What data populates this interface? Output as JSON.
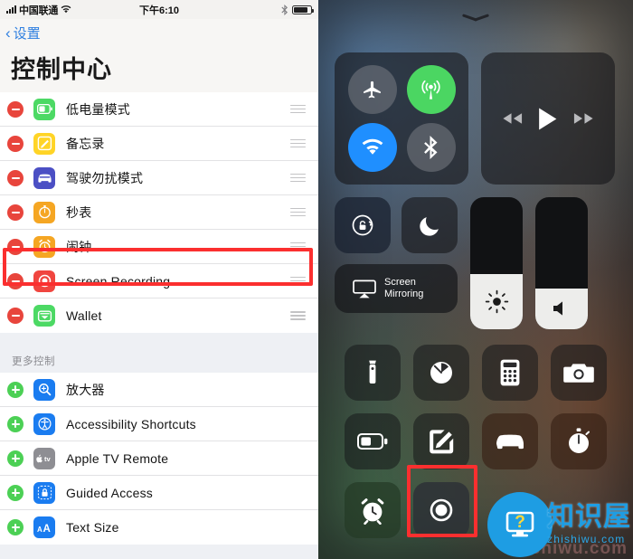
{
  "status_bar": {
    "carrier": "中国联通",
    "time": "下午6:10",
    "signal_icon": "signal-bars-icon",
    "wifi_icon": "wifi-icon",
    "bluetooth_icon": "bluetooth-icon",
    "battery_icon": "battery-icon"
  },
  "nav": {
    "back_label": "设置",
    "back_icon": "chevron-left-icon",
    "page_title": "控制中心"
  },
  "included_section": {
    "items": [
      {
        "label": "低电量模式",
        "icon": "battery-low-power-icon",
        "icon_color": "#4cd964",
        "action": "remove"
      },
      {
        "label": "备忘录",
        "icon": "notes-icon",
        "icon_color": "#ffd426",
        "action": "remove"
      },
      {
        "label": "驾驶勿扰模式",
        "icon": "car-do-not-disturb-icon",
        "icon_color": "#4b4fc4",
        "action": "remove"
      },
      {
        "label": "秒表",
        "icon": "stopwatch-icon",
        "icon_color": "#f5a623",
        "action": "remove"
      },
      {
        "label": "闹钟",
        "icon": "alarm-clock-icon",
        "icon_color": "#f5a623",
        "action": "remove"
      },
      {
        "label": "Screen Recording",
        "icon": "screen-recording-icon",
        "icon_color": "#f0453f",
        "action": "remove",
        "highlighted": true
      },
      {
        "label": "Wallet",
        "icon": "wallet-icon",
        "icon_color": "#4cd964",
        "action": "remove"
      }
    ]
  },
  "more_section": {
    "header": "更多控制",
    "items": [
      {
        "label": "放大器",
        "icon": "magnifier-icon",
        "icon_color": "#1a7cf0",
        "action": "add"
      },
      {
        "label": "Accessibility Shortcuts",
        "icon": "accessibility-icon",
        "icon_color": "#1a7cf0",
        "action": "add"
      },
      {
        "label": "Apple TV Remote",
        "icon": "apple-tv-remote-icon",
        "icon_color": "#8e8e93",
        "action": "add"
      },
      {
        "label": "Guided Access",
        "icon": "guided-access-lock-icon",
        "icon_color": "#1a7cf0",
        "action": "add"
      },
      {
        "label": "Text Size",
        "icon": "text-size-icon",
        "icon_color": "#1a7cf0",
        "action": "add"
      }
    ]
  },
  "control_center": {
    "grabber_icon": "chevron-down-grabber-icon",
    "connectivity": [
      {
        "name": "airplane-mode-toggle",
        "icon": "airplane-icon",
        "state": "off"
      },
      {
        "name": "cellular-data-toggle",
        "icon": "cellular-antenna-icon",
        "state": "on",
        "color": "#4bd662"
      },
      {
        "name": "wifi-toggle",
        "icon": "wifi-icon",
        "state": "on",
        "color": "#1f8fff"
      },
      {
        "name": "bluetooth-toggle",
        "icon": "bluetooth-icon",
        "state": "off"
      }
    ],
    "media": [
      {
        "name": "rewind-button",
        "icon": "rewind-icon"
      },
      {
        "name": "play-button",
        "icon": "play-icon"
      },
      {
        "name": "fast-forward-button",
        "icon": "fast-forward-icon"
      }
    ],
    "rotation_lock": {
      "icon": "rotation-lock-icon",
      "state": "on"
    },
    "do_not_disturb": {
      "icon": "moon-icon",
      "state": "off"
    },
    "screen_mirroring": {
      "label_line1": "Screen",
      "label_line2": "Mirroring",
      "icon": "airplay-icon"
    },
    "brightness_slider": {
      "icon": "brightness-sun-icon",
      "value_percent": 42
    },
    "volume_slider": {
      "icon": "speaker-icon",
      "value_percent": 31
    },
    "apps": [
      {
        "name": "flashlight-tile",
        "icon": "flashlight-icon",
        "tint": "dark"
      },
      {
        "name": "timer-tile",
        "icon": "timer-icon",
        "tint": "dark"
      },
      {
        "name": "calculator-tile",
        "icon": "calculator-icon",
        "tint": "dark"
      },
      {
        "name": "camera-tile",
        "icon": "camera-icon",
        "tint": "dark"
      },
      {
        "name": "low-power-tile",
        "icon": "battery-low-power-icon",
        "tint": "dark"
      },
      {
        "name": "notes-tile",
        "icon": "notes-pencil-icon",
        "tint": "dark"
      },
      {
        "name": "driving-dnd-tile",
        "icon": "car-icon",
        "tint": "warm"
      },
      {
        "name": "stopwatch-tile",
        "icon": "stopwatch-icon",
        "tint": "warm"
      },
      {
        "name": "alarm-tile",
        "icon": "alarm-clock-icon",
        "tint": "green"
      },
      {
        "name": "screen-recording-tile",
        "icon": "record-circle-icon",
        "tint": "slate",
        "highlighted": true
      }
    ]
  },
  "watermark": {
    "logo_icon": "monitor-question-logo-icon",
    "cn_text": "知识屋",
    "url_text": "zhishiwu.com",
    "ghost_text": "zhishiwu.com",
    "brand_color": "#1e9de3"
  },
  "annotations": {
    "highlight_color": "#fb2f2f"
  }
}
